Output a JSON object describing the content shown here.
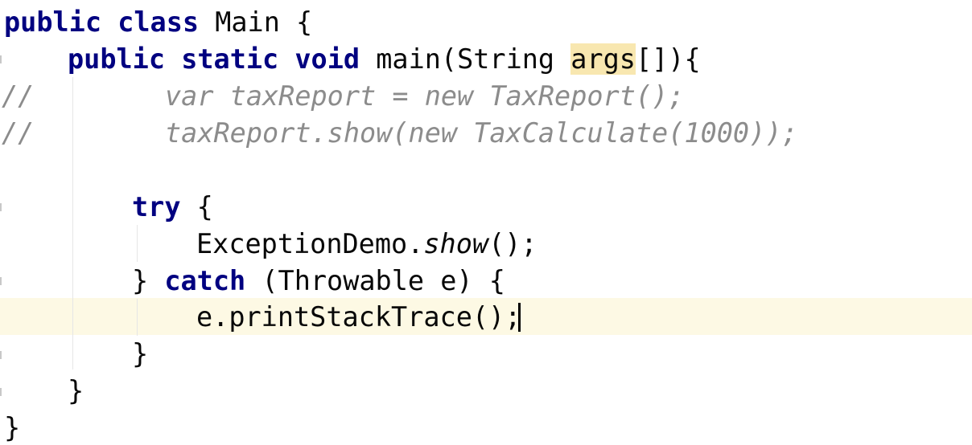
{
  "editor": {
    "lines": [
      {
        "kw1": "public",
        "kw2": "class",
        "rest": " Main {"
      },
      {
        "kw1": "public",
        "kw2": "static",
        "kw3": "void",
        "pre": " main(String ",
        "param": "args",
        "post": "[]){"
      },
      {
        "comment_marker": "//",
        "code": "var taxReport = new TaxReport();"
      },
      {
        "comment_marker": "//",
        "code": "taxReport.show(new TaxCalculate(1000));"
      },
      {
        "kw": "try",
        "rest": " {"
      },
      {
        "cls": "ExceptionDemo.",
        "method": "show",
        "rest": "();"
      },
      {
        "brace": "}",
        "kw": "catch",
        "rest": " (Throwable e) {"
      },
      {
        "code": "e.printStackTrace();"
      },
      {
        "code": "}"
      },
      {
        "code": "}"
      },
      {
        "code": "}"
      }
    ]
  },
  "colors": {
    "keyword": "#000080",
    "comment": "#8c8c8c",
    "current_line": "#fdf9e4",
    "identifier_highlight": "#f8e7b0"
  }
}
